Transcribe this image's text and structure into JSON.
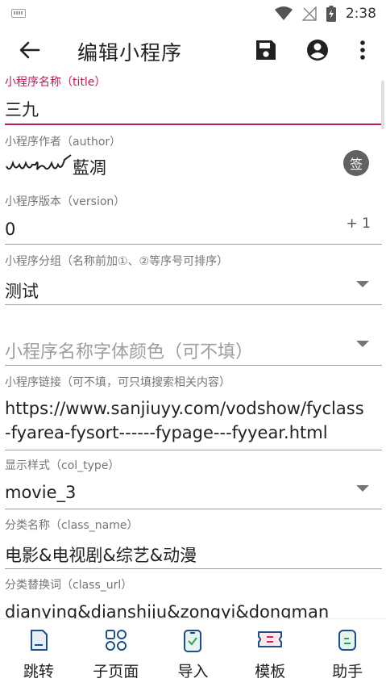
{
  "status_bar": {
    "time": "2:38"
  },
  "app_bar": {
    "title": "编辑小程序"
  },
  "fields": {
    "title": {
      "label": "小程序名称（title）",
      "value": "三九"
    },
    "author": {
      "label": "小程序作者（author）",
      "value": "藍凋",
      "signature_button": "签"
    },
    "version": {
      "label": "小程序版本（version）",
      "value": "0",
      "increment": "+ 1"
    },
    "group": {
      "label": "小程序分组（名称前加①、②等序号可排序）",
      "value": "测试"
    },
    "color": {
      "placeholder": "小程序名称字体颜色（可不填）"
    },
    "url": {
      "label": "小程序链接（可不填，可只填搜索相关内容）",
      "line1": "https://www.sanjiuyy.com/vodshow/fyclass",
      "line2": "-fyarea-fysort------fypage---fyyear.html"
    },
    "col_type": {
      "label": "显示样式（col_type）",
      "value": "movie_3"
    },
    "class_name": {
      "label": "分类名称（class_name）",
      "value": "电影&电视剧&综艺&动漫"
    },
    "class_url": {
      "label": "分类替换词（class_url）",
      "value": "dianying&dianshiju&zongyi&dongman"
    }
  },
  "bottom_nav": [
    {
      "label": "跳转",
      "icon": "document-icon"
    },
    {
      "label": "子页面",
      "icon": "grid-circles-icon"
    },
    {
      "label": "导入",
      "icon": "import-phone-icon"
    },
    {
      "label": "模板",
      "icon": "ticket-icon"
    },
    {
      "label": "助手",
      "icon": "assistant-icon"
    }
  ],
  "colors": {
    "accent": "#c2185b",
    "text": "#212121",
    "label": "#757575",
    "icon_blue": "#1e4e8c"
  }
}
